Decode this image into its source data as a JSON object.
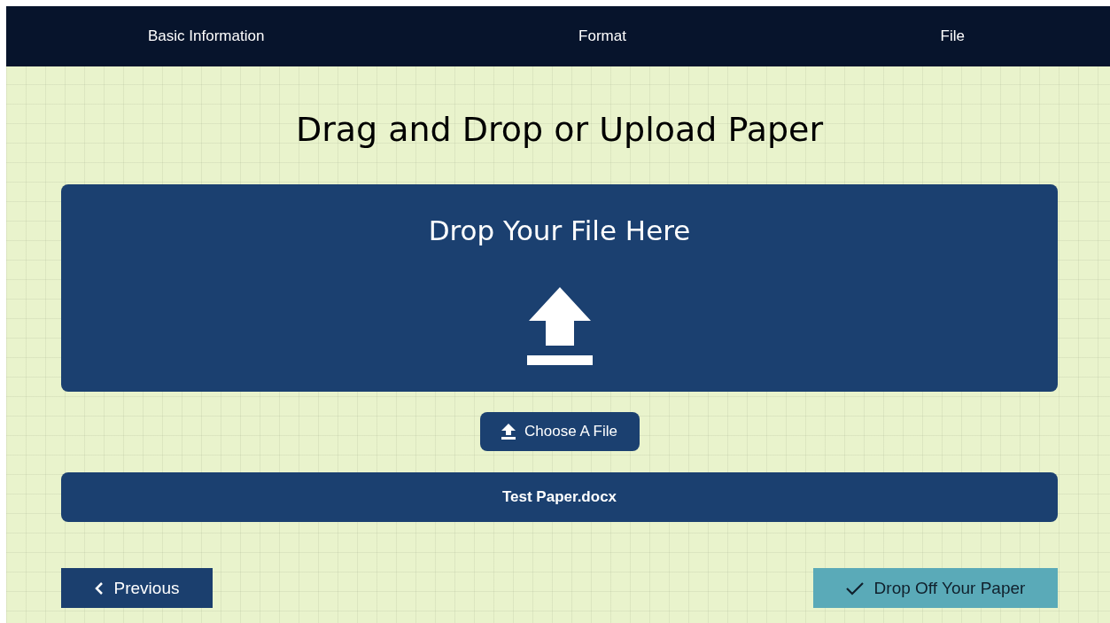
{
  "steps": [
    {
      "label": "Basic Information"
    },
    {
      "label": "Format"
    },
    {
      "label": "File"
    }
  ],
  "title": "Drag and Drop or Upload Paper",
  "dropzone": {
    "heading": "Drop Your File Here"
  },
  "choose_button": {
    "label": "Choose A File"
  },
  "selected_file": "Test Paper.docx",
  "buttons": [
    {
      "kind": "previous",
      "label": "Previous"
    },
    {
      "kind": "submit",
      "label": "Drop Off Your Paper"
    }
  ]
}
